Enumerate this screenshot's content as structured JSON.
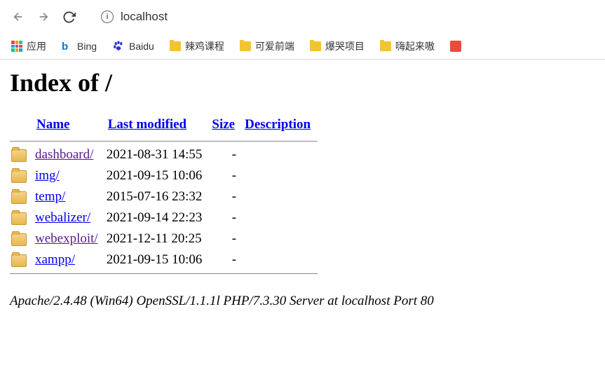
{
  "browser": {
    "url": "localhost"
  },
  "bookmarks": {
    "apps": "应用",
    "items": [
      {
        "label": "Bing",
        "icon": "bing"
      },
      {
        "label": "Baidu",
        "icon": "baidu"
      },
      {
        "label": "辣鸡课程",
        "icon": "folder"
      },
      {
        "label": "可爱前端",
        "icon": "folder"
      },
      {
        "label": "爆哭项目",
        "icon": "folder"
      },
      {
        "label": "嗨起来嗷",
        "icon": "folder"
      }
    ]
  },
  "page": {
    "title": "Index of /",
    "headers": {
      "name": "Name",
      "modified": "Last modified",
      "size": "Size",
      "description": "Description"
    },
    "entries": [
      {
        "name": "dashboard/",
        "modified": "2021-08-31 14:55",
        "size": "-"
      },
      {
        "name": "img/",
        "modified": "2021-09-15 10:06",
        "size": "-"
      },
      {
        "name": "temp/",
        "modified": "2015-07-16 23:32",
        "size": "-"
      },
      {
        "name": "webalizer/",
        "modified": "2021-09-14 22:23",
        "size": "-"
      },
      {
        "name": "webexploit/",
        "modified": "2021-12-11 20:25",
        "size": "-"
      },
      {
        "name": "xampp/",
        "modified": "2021-09-15 10:06",
        "size": "-"
      }
    ],
    "footer": "Apache/2.4.48 (Win64) OpenSSL/1.1.1l PHP/7.3.30 Server at localhost Port 80"
  }
}
